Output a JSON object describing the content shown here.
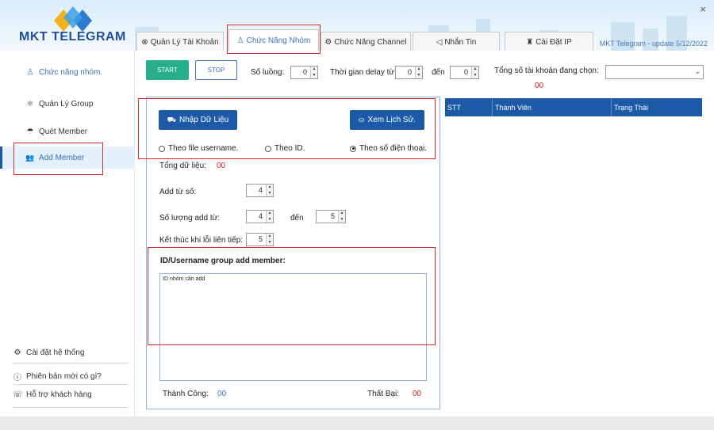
{
  "app": {
    "logo_text": "MKT TELEGRAM",
    "update_text": "MKT Telegram - update 5/12/2022",
    "close_glyph": "×",
    "colors": {
      "primary": "#1c5aa8",
      "start_green": "#27ae8a",
      "error_red": "#d91e1e",
      "highlight_red": "#d42a2a"
    }
  },
  "tabs": [
    {
      "label": "Quản Lý Tài Khoản",
      "icon": "⊗",
      "icon_name": "account-manage-icon"
    },
    {
      "label": "Chức Năng Nhóm",
      "icon": "♙",
      "icon_name": "group-function-icon",
      "active": true
    },
    {
      "label": "Chức Năng Channel",
      "icon": "⚙",
      "icon_name": "channel-function-icon"
    },
    {
      "label": "Nhắn Tin",
      "icon": "◁",
      "icon_name": "message-icon"
    },
    {
      "label": "Cài Đặt IP",
      "icon": "♜",
      "icon_name": "ip-settings-icon"
    }
  ],
  "sidebar": {
    "title": {
      "label": "Chức năng nhóm.",
      "icon": "♙"
    },
    "items": [
      {
        "label": "Quản Lý Group",
        "icon": "⚛",
        "icon_name": "group-manage-icon"
      },
      {
        "label": "Quét Member",
        "icon": "☂",
        "icon_name": "scan-member-icon"
      },
      {
        "label": "Add Member",
        "icon": "👥",
        "icon_name": "add-member-icon",
        "active": true
      }
    ],
    "bottom": [
      {
        "label": "Cài đặt hệ thống",
        "icon": "⚙",
        "icon_name": "system-settings-icon"
      },
      {
        "label": "Phiên bản mới có gì?",
        "icon": "ⓘ",
        "icon_name": "info-icon"
      },
      {
        "label": "Hỗ trợ khách hàng",
        "icon": "☏",
        "icon_name": "support-icon"
      }
    ]
  },
  "controls": {
    "start_label": "START",
    "stop_label": "STOP",
    "threads_label": "Số luồng:",
    "threads_value": "0",
    "delay_label": "Thời gian delay từ:",
    "delay_from": "0",
    "delay_to_label": "đến",
    "delay_to": "0",
    "selected_accounts_label": "Tổng số tài khoản đang chọn:",
    "selected_accounts_count": "00",
    "account_select_value": ""
  },
  "form": {
    "import_button": "Nhập Dữ Liệu",
    "import_icon": "⛟",
    "history_button": "Xem Lịch Sử.",
    "history_icon": "⛀",
    "radio_username": "Theo file username.",
    "radio_id": "Theo ID.",
    "radio_phone": "Theo số điện thoại.",
    "selected_radio": "phone",
    "total_data_label": "Tổng dữ liệu:",
    "total_data_value": "00",
    "add_from_label": "Add từ số:",
    "add_from_value": "4",
    "add_amount_label": "Số lượng add từ:",
    "add_amount_from": "4",
    "add_amount_to_label": "đến",
    "add_amount_to": "5",
    "stop_on_errors_label": "Kết thúc khi lỗi liên tiếp:",
    "stop_on_errors_value": "5",
    "group_id_label": "ID/Username group add member:",
    "group_id_text": "ID nhóm cần add",
    "success_label": "Thành Công:",
    "success_value": "00",
    "fail_label": "Thất Bại:",
    "fail_value": "00"
  },
  "table": {
    "headers": [
      "STT",
      "Thành Viên",
      "Trạng Thái"
    ],
    "rows": []
  }
}
